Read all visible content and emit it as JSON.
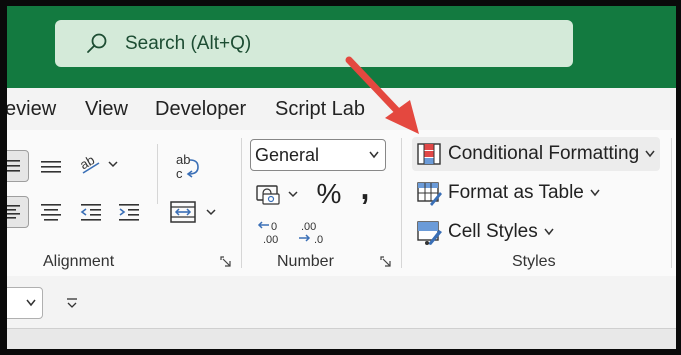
{
  "search": {
    "placeholder": "Search (Alt+Q)"
  },
  "tabs": [
    "eview",
    "View",
    "Developer",
    "Script Lab"
  ],
  "groups": {
    "alignment": "Alignment",
    "number": "Number",
    "styles": "Styles"
  },
  "number_format": {
    "value": "General"
  },
  "number_buttons": {
    "percent": "%",
    "comma": ","
  },
  "styles": {
    "conditional_formatting": "Conditional Formatting",
    "format_as_table": "Format as Table",
    "cell_styles": "Cell Styles"
  },
  "colors": {
    "titlebar": "#137a40",
    "search_bg": "#d4ead9",
    "arrow": "#e4483f"
  }
}
